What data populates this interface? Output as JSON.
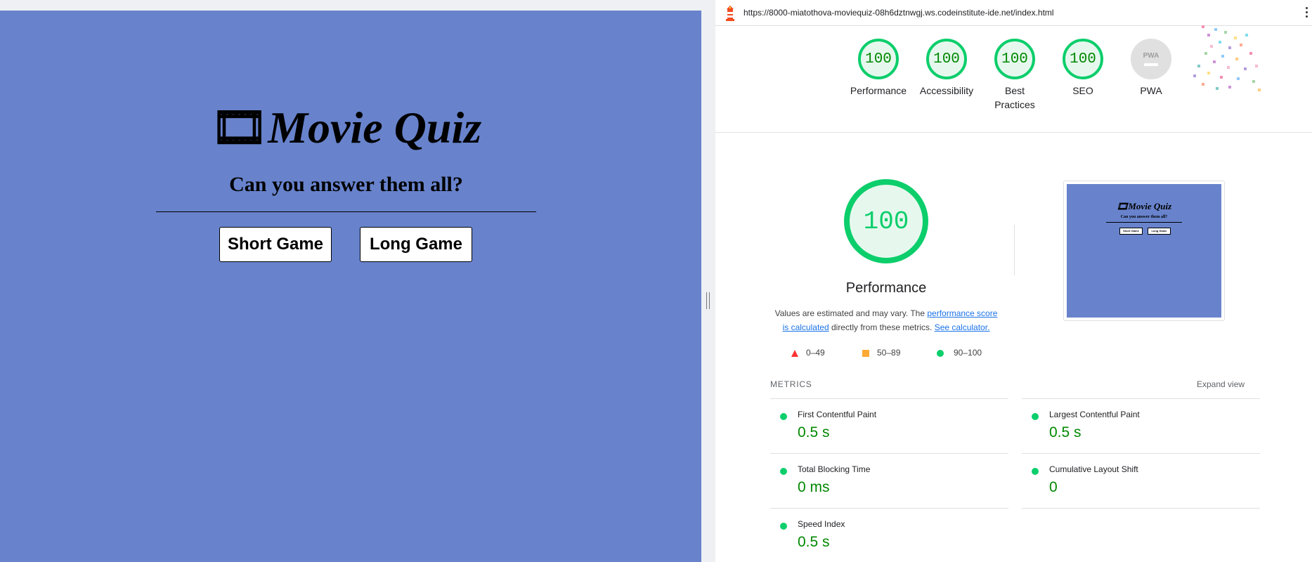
{
  "quiz": {
    "title_icon": "🎞",
    "title": "Movie Quiz",
    "subtitle": "Can you answer them all?",
    "buttons": {
      "short": "Short Game",
      "long": "Long Game"
    },
    "background_color": "#6883cc"
  },
  "report": {
    "url": "https://8000-miatothova-moviequiz-08h6dztnwgj.ws.codeinstitute-ide.net/index.html",
    "summary_scores": [
      {
        "score": "100",
        "label": "Performance"
      },
      {
        "score": "100",
        "label": "Accessibility"
      },
      {
        "score": "100",
        "label": "Best Practices"
      },
      {
        "score": "100",
        "label": "SEO"
      }
    ],
    "pwa": {
      "badge_text": "PWA",
      "label": "PWA"
    },
    "performance": {
      "score": "100",
      "title": "Performance",
      "note_prefix": "Values are estimated and may vary. The ",
      "note_link1": "performance score is calculated",
      "note_middle": " directly from these metrics. ",
      "note_link2": "See calculator."
    },
    "legend": {
      "fail": "0–49",
      "average": "50–89",
      "pass": "90–100"
    },
    "screenshot": {
      "title_icon": "🎞",
      "title": "Movie Quiz",
      "subtitle": "Can you answer them all?",
      "short": "Short Game",
      "long": "Long Game"
    },
    "metrics_heading": "METRICS",
    "expand_view": "Expand view",
    "metrics": [
      {
        "name": "First Contentful Paint",
        "value": "0.5 s"
      },
      {
        "name": "Largest Contentful Paint",
        "value": "0.5 s"
      },
      {
        "name": "Total Blocking Time",
        "value": "0 ms"
      },
      {
        "name": "Cumulative Layout Shift",
        "value": "0"
      },
      {
        "name": "Speed Index",
        "value": "0.5 s"
      }
    ],
    "colors": {
      "pass": "#0cce6b",
      "pass_text": "#008800",
      "average": "#ffaa33",
      "fail": "#ff3333",
      "link": "#1a73e8"
    }
  }
}
